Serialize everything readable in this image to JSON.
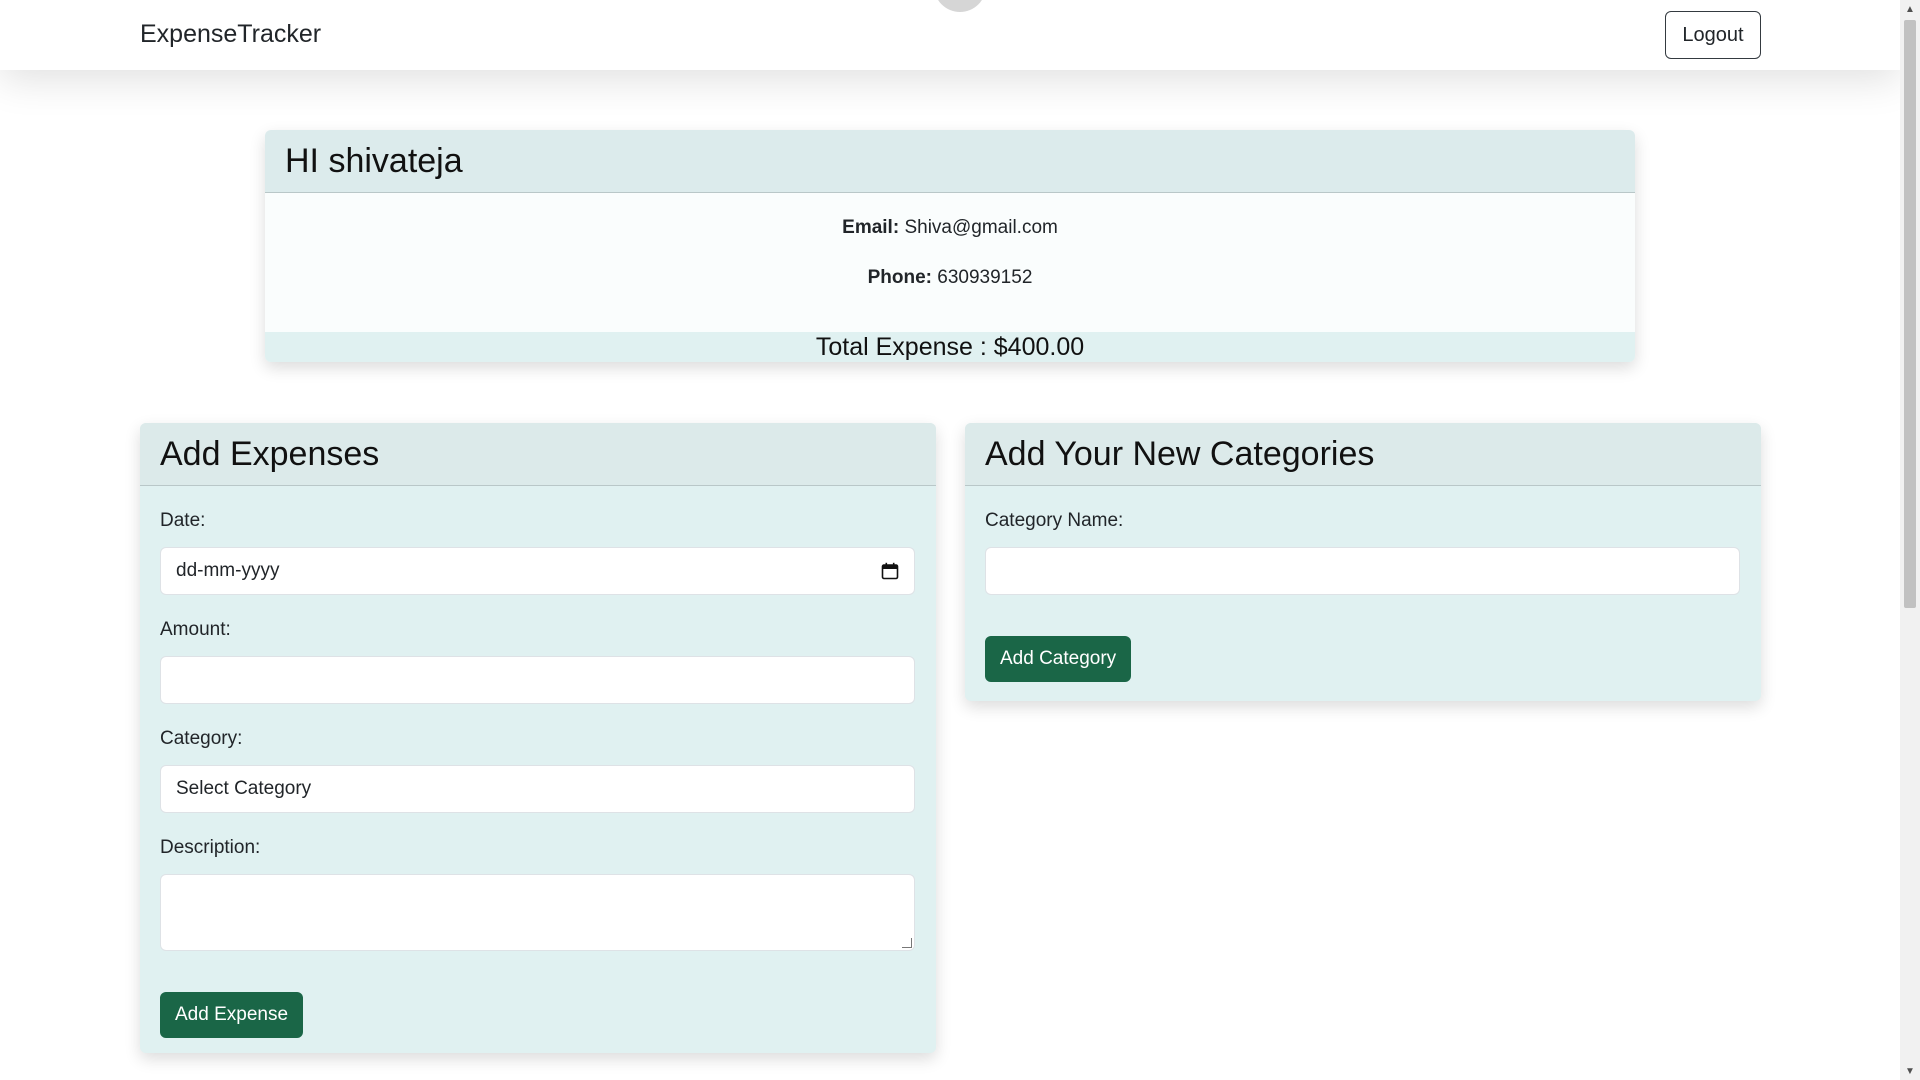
{
  "navbar": {
    "brand": "ExpenseTracker",
    "logout_label": "Logout"
  },
  "profile": {
    "greeting": "HI shivateja",
    "email_label": "Email:",
    "email_value": "Shiva@gmail.com",
    "phone_label": "Phone:",
    "phone_value": "630939152",
    "total_expense": "Total Expense : $400.00"
  },
  "add_expense": {
    "title": "Add Expenses",
    "date_label": "Date:",
    "date_placeholder": "dd-mm-yyyy",
    "amount_label": "Amount:",
    "amount_value": "",
    "category_label": "Category:",
    "category_selected": "Select Category",
    "description_label": "Description:",
    "description_value": "",
    "submit_label": "Add Expense"
  },
  "add_category": {
    "title": "Add Your New Categories",
    "name_label": "Category Name:",
    "name_value": "",
    "submit_label": "Add Category"
  },
  "icons": {
    "date_picker": "calendar-icon",
    "scroll_up": "arrow-up-icon",
    "scroll_down": "arrow-down-icon"
  },
  "colors": {
    "primary_button": "#1a6647",
    "card_background": "#e0f1f1",
    "card_header": "#dceaea"
  }
}
